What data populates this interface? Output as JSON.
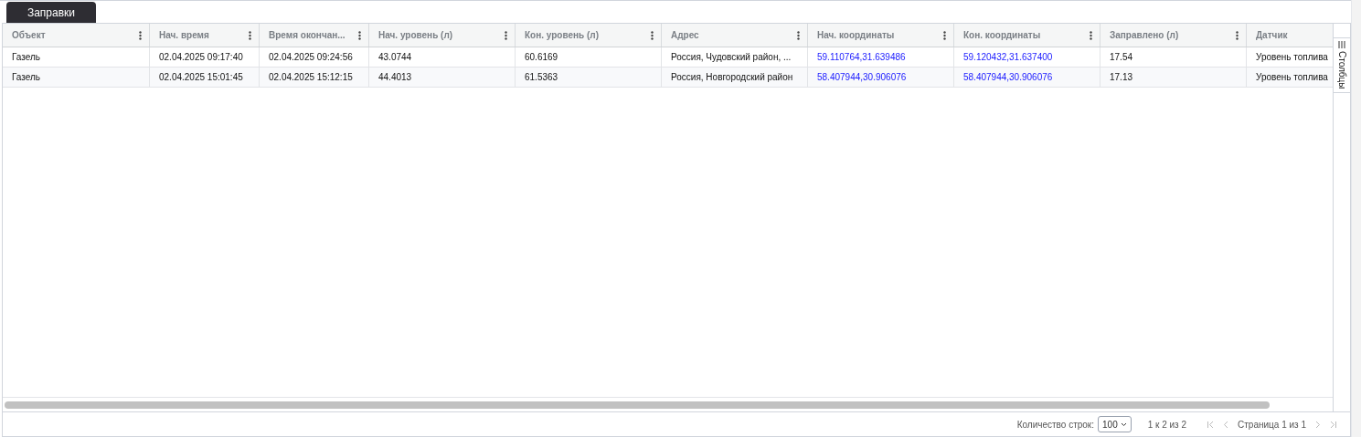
{
  "tabs": [
    {
      "label": "Заправки",
      "selected": true
    }
  ],
  "table": {
    "columns": [
      {
        "label": "Объект",
        "kind": "text",
        "menu": true
      },
      {
        "label": "Нач. время",
        "kind": "text",
        "menu": true
      },
      {
        "label": "Время окончан...",
        "kind": "text",
        "menu": true
      },
      {
        "label": "Нач. уровень (л)",
        "kind": "text",
        "menu": true
      },
      {
        "label": "Кон. уровень (л)",
        "kind": "text",
        "menu": true
      },
      {
        "label": "Адрес",
        "kind": "text",
        "menu": true
      },
      {
        "label": "Нач. координаты",
        "kind": "link",
        "menu": true
      },
      {
        "label": "Кон. координаты",
        "kind": "link",
        "menu": true
      },
      {
        "label": "Заправлено (л)",
        "kind": "text",
        "menu": true
      },
      {
        "label": "Датчик",
        "kind": "text",
        "menu": false
      }
    ],
    "rows": [
      [
        "Газель",
        "02.04.2025 09:17:40",
        "02.04.2025 09:24:56",
        "43.0744",
        "60.6169",
        "Россия, Чудовский район, ...",
        "59.110764,31.639486",
        "59.120432,31.637400",
        "17.54",
        "Уровень топлива"
      ],
      [
        "Газель",
        "02.04.2025 15:01:45",
        "02.04.2025 15:12:15",
        "44.4013",
        "61.5363",
        "Россия, Новгородский район",
        "58.407944,30.906076",
        "58.407944,30.906076",
        "17.13",
        "Уровень топлива"
      ]
    ]
  },
  "side_panel": {
    "label": "Столбцы"
  },
  "footer": {
    "page_size_label": "Количество строк:",
    "page_size": "100",
    "range": "1 к 2 из 2",
    "page": "Страница 1 из 1"
  }
}
